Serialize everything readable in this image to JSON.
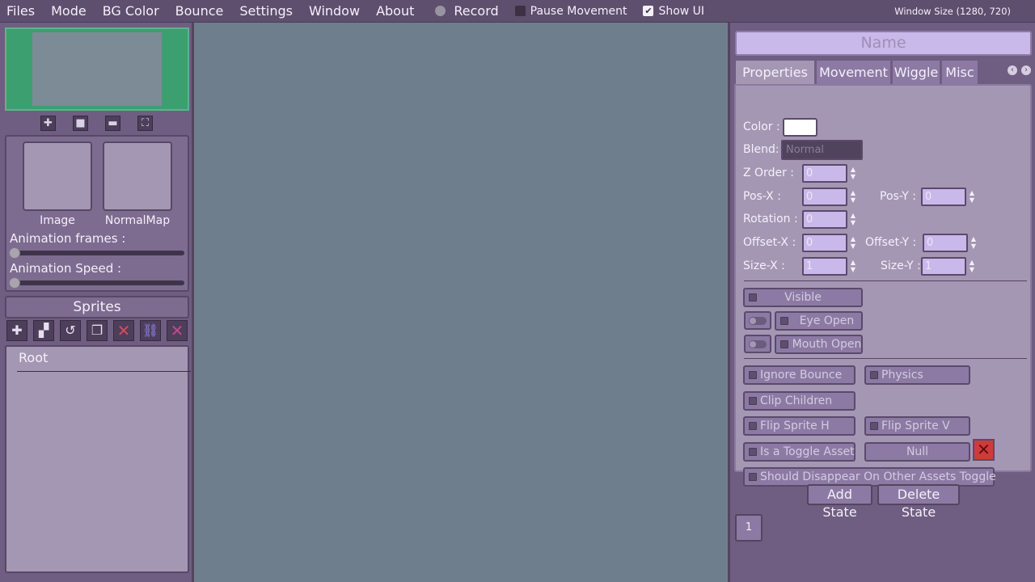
{
  "menu": {
    "items": [
      "Files",
      "Mode",
      "BG Color",
      "Bounce",
      "Settings",
      "Window",
      "About"
    ],
    "record_label": "Record",
    "pause_movement_label": "Pause Movement",
    "pause_movement_checked": false,
    "show_ui_label": "Show UI",
    "show_ui_checked": true,
    "window_size": "Window Size (1280, 720)"
  },
  "left": {
    "image_label": "Image",
    "normalmap_label": "NormalMap",
    "animation_frames_label": "Animation frames :",
    "animation_frames_value": 0,
    "animation_speed_label": "Animation Speed :",
    "animation_speed_value": 0,
    "sprites_title": "Sprites",
    "tree_root": "Root"
  },
  "right": {
    "name_placeholder": "Name",
    "tabs": [
      "Properties",
      "Movement",
      "Wiggle",
      "Misc"
    ],
    "active_tab": "Properties",
    "fields": {
      "color_label": "Color :",
      "color_value": "#ffffff",
      "blend_label": "Blend:",
      "blend_value": "Normal",
      "z_order_label": "Z Order :",
      "z_order_value": "0",
      "pos_x_label": "Pos-X :",
      "pos_x_value": "0",
      "pos_y_label": "Pos-Y :",
      "pos_y_value": "0",
      "rotation_label": "Rotation :",
      "rotation_value": "0",
      "offset_x_label": "Offset-X :",
      "offset_x_value": "0",
      "offset_y_label": "Offset-Y :",
      "offset_y_value": "0",
      "size_x_label": "Size-X :",
      "size_x_value": "1",
      "size_y_label": "Size-Y :",
      "size_y_value": "1"
    },
    "checks": {
      "visible": "Visible",
      "eye_open": "Eye Open",
      "mouth_open": "Mouth Open",
      "ignore_bounce": "Ignore Bounce",
      "physics": "Physics",
      "clip_children": "Clip Children",
      "flip_h": "Flip Sprite H",
      "flip_v": "Flip Sprite V",
      "toggle_asset": "Is a Toggle Asset",
      "null_label": "Null",
      "disappear": "Should Disappear On Other Assets Toggle"
    },
    "add_state": "Add State",
    "delete_state": "Delete State",
    "states": [
      "1"
    ]
  }
}
